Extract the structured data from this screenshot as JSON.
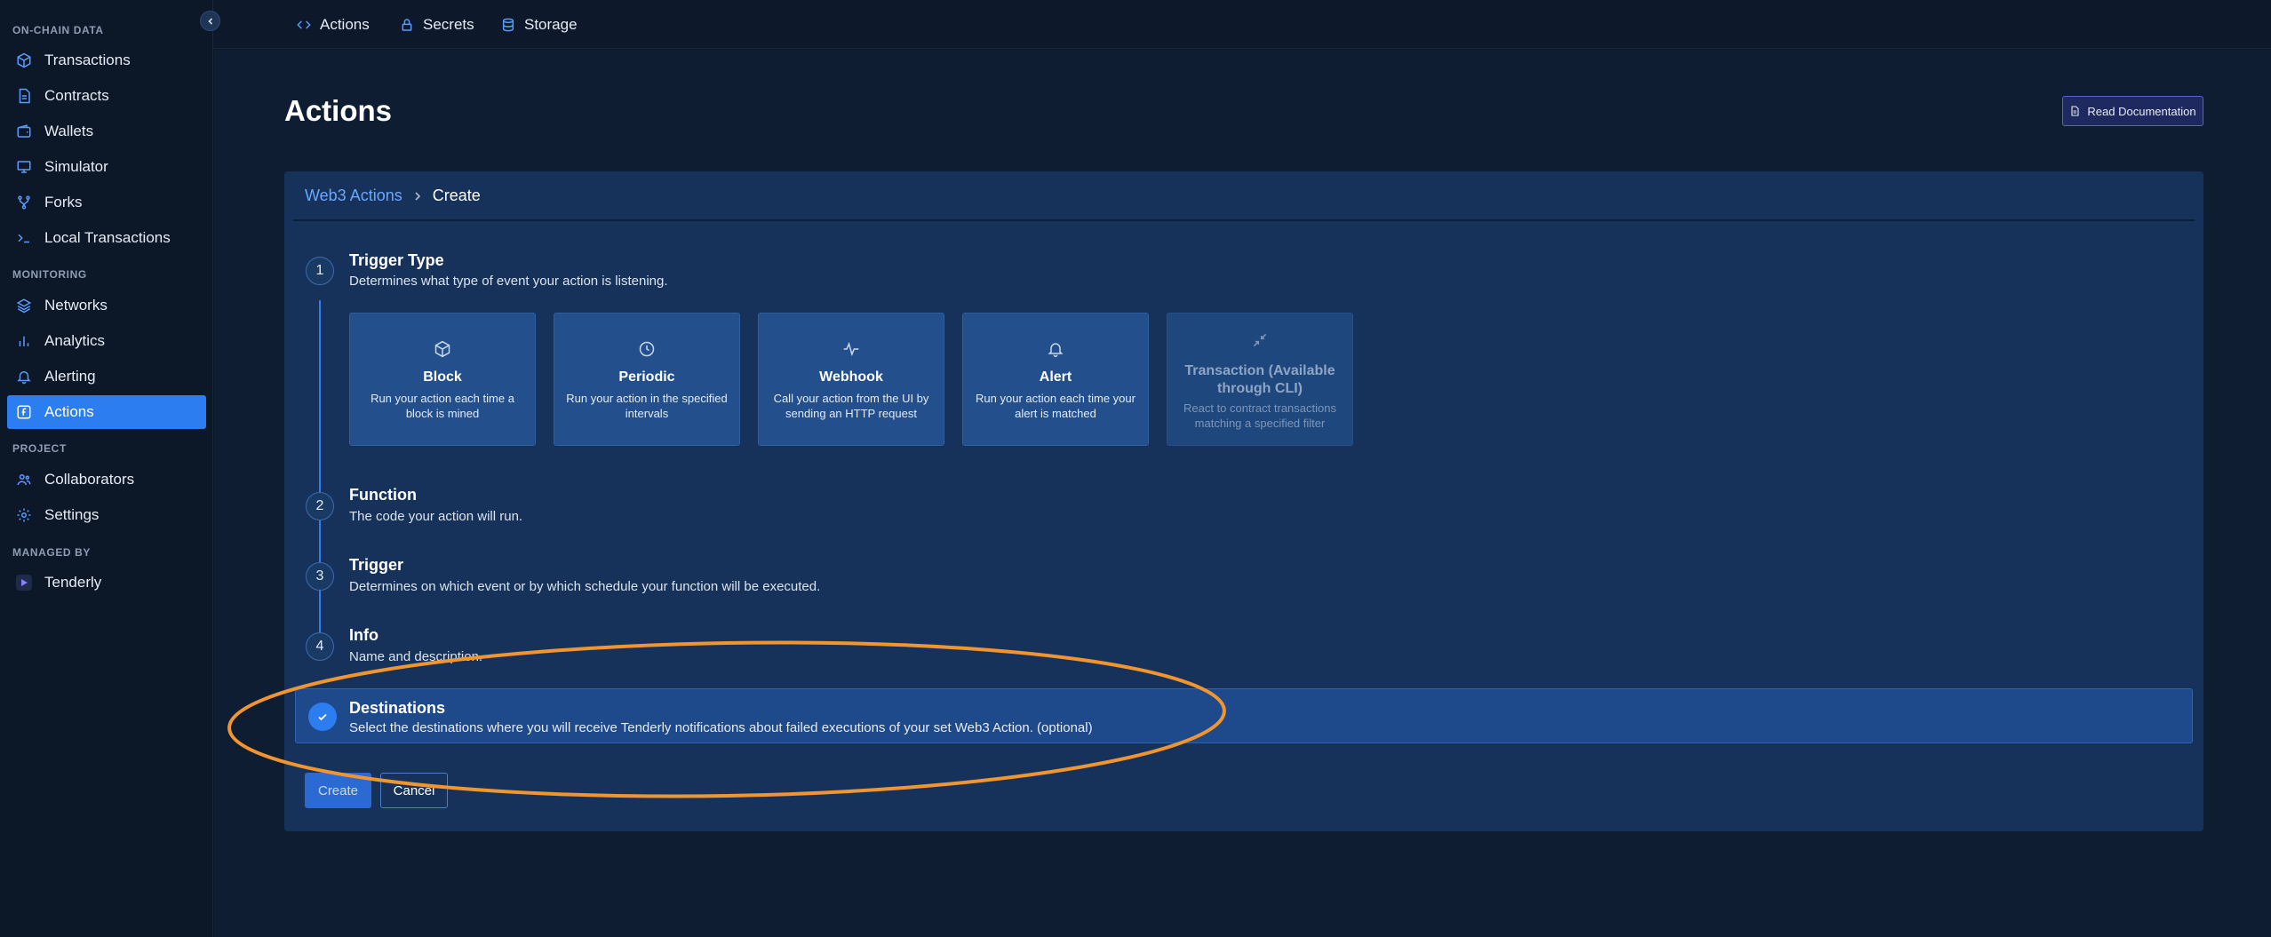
{
  "sidebar": {
    "sections": [
      {
        "label": "ON-CHAIN DATA"
      },
      {
        "label": "MONITORING"
      },
      {
        "label": "PROJECT"
      },
      {
        "label": "MANAGED BY"
      }
    ],
    "items": [
      {
        "label": "Transactions",
        "icon": "cube-icon"
      },
      {
        "label": "Contracts",
        "icon": "document-icon"
      },
      {
        "label": "Wallets",
        "icon": "wallet-icon"
      },
      {
        "label": "Simulator",
        "icon": "monitor-icon"
      },
      {
        "label": "Forks",
        "icon": "fork-icon"
      },
      {
        "label": "Local Transactions",
        "icon": "terminal-icon"
      },
      {
        "label": "Networks",
        "icon": "layers-icon"
      },
      {
        "label": "Analytics",
        "icon": "bar-chart-icon"
      },
      {
        "label": "Alerting",
        "icon": "bell-icon"
      },
      {
        "label": "Actions",
        "icon": "function-icon",
        "active": true
      },
      {
        "label": "Collaborators",
        "icon": "users-icon"
      },
      {
        "label": "Settings",
        "icon": "gear-icon"
      },
      {
        "label": "Tenderly",
        "icon": "tenderly-logo"
      }
    ]
  },
  "topbar": {
    "tabs": [
      {
        "label": "Actions",
        "icon": "code-icon"
      },
      {
        "label": "Secrets",
        "icon": "lock-icon"
      },
      {
        "label": "Storage",
        "icon": "database-icon"
      }
    ]
  },
  "page": {
    "title": "Actions",
    "doc_button": "Read Documentation"
  },
  "breadcrumb": {
    "parent": "Web3 Actions",
    "current": "Create"
  },
  "steps": [
    {
      "number": "1",
      "title": "Trigger Type",
      "description": "Determines what type of event your action is listening."
    },
    {
      "number": "2",
      "title": "Function",
      "description": "The code your action will run."
    },
    {
      "number": "3",
      "title": "Trigger",
      "description": "Determines on which event or by which schedule your function will be executed."
    },
    {
      "number": "4",
      "title": "Info",
      "description": "Name and description."
    }
  ],
  "trigger_types": [
    {
      "title": "Block",
      "description": "Run your action each time a block is mined",
      "icon": "cube-icon",
      "disabled": false
    },
    {
      "title": "Periodic",
      "description": "Run your action in the specified intervals",
      "icon": "clock-icon",
      "disabled": false
    },
    {
      "title": "Webhook",
      "description": "Call your action from the UI by sending an HTTP request",
      "icon": "pulse-icon",
      "disabled": false
    },
    {
      "title": "Alert",
      "description": "Run your action each time your alert is matched",
      "icon": "bell-icon",
      "disabled": false
    },
    {
      "title": "Transaction (Available through CLI)",
      "description": "React to contract transactions matching a specified filter",
      "icon": "collapse-arrows-icon",
      "disabled": true
    }
  ],
  "destinations": {
    "title": "Destinations",
    "description": "Select the destinations where you will receive Tenderly notifications about failed executions of your set Web3 Action. (optional)"
  },
  "buttons": {
    "create": "Create",
    "cancel": "Cancel"
  },
  "colors": {
    "accent": "#2c7df0",
    "highlight": "#f0952f",
    "background": "#0f1d33",
    "card": "#16325a"
  }
}
